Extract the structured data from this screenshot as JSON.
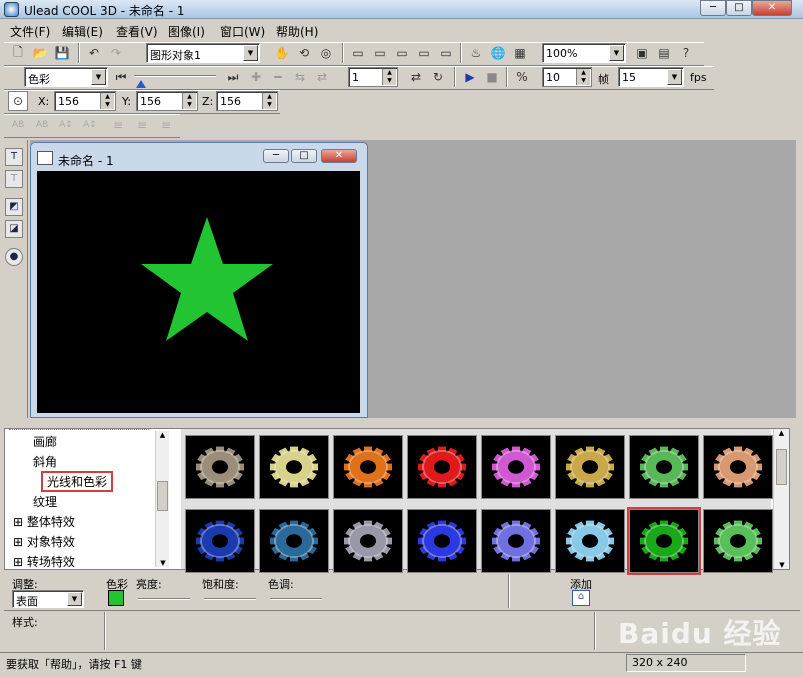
{
  "window": {
    "title": "Ulead COOL 3D - 未命名 - 1",
    "minimize": "─",
    "maximize": "□",
    "close": "✕"
  },
  "menu": [
    "文件(F)",
    "编辑(E)",
    "查看(V)",
    "图像(I)",
    "窗口(W)",
    "帮助(H)"
  ],
  "toolbar": {
    "object_combo": "图形对象1",
    "zoom_combo": "100%",
    "attribute_combo": "色彩",
    "frame_value": "1",
    "frame_count": "10",
    "frame_label": "帧",
    "fps_value": "15",
    "fps_label": "fps"
  },
  "position": {
    "x_label": "X:",
    "x": "156",
    "y_label": "Y:",
    "y": "156",
    "z_label": "Z:",
    "z": "156"
  },
  "document": {
    "title": "未命名 - 1",
    "background_color": "#000000",
    "star_color": "#22c432"
  },
  "tree": {
    "items": [
      "画廊",
      "斜角",
      "光线和色彩",
      "纹理",
      "整体特效",
      "对象特效",
      "转场特效"
    ],
    "selected": "光线和色彩"
  },
  "thumbnails": {
    "row1": [
      "#9a8e7a",
      "#d8d28a",
      "#e0701a",
      "#e01a1a",
      "#d058d0",
      "#c8a848",
      "#58b858",
      "#d89870"
    ],
    "row2": [
      "#1a3ab0",
      "#2a6a9a",
      "#9898a8",
      "#2a3ae0",
      "#7070e0",
      "#88c8e8",
      "#18a818",
      "#58c058"
    ],
    "selected_index_row2": 6
  },
  "properties": {
    "adjust_label": "调整:",
    "adjust_value": "表面",
    "color_label": "色彩",
    "color_swatch": "#22c432",
    "brightness_label": "亮度:",
    "saturation_label": "饱和度:",
    "hue_label": "色调:",
    "add_label": "添加",
    "style_label": "样式:"
  },
  "status": {
    "help_text": "要获取「帮助」，请按 F1 键",
    "size": "320 x 240"
  },
  "watermark": "Baidu 经验"
}
